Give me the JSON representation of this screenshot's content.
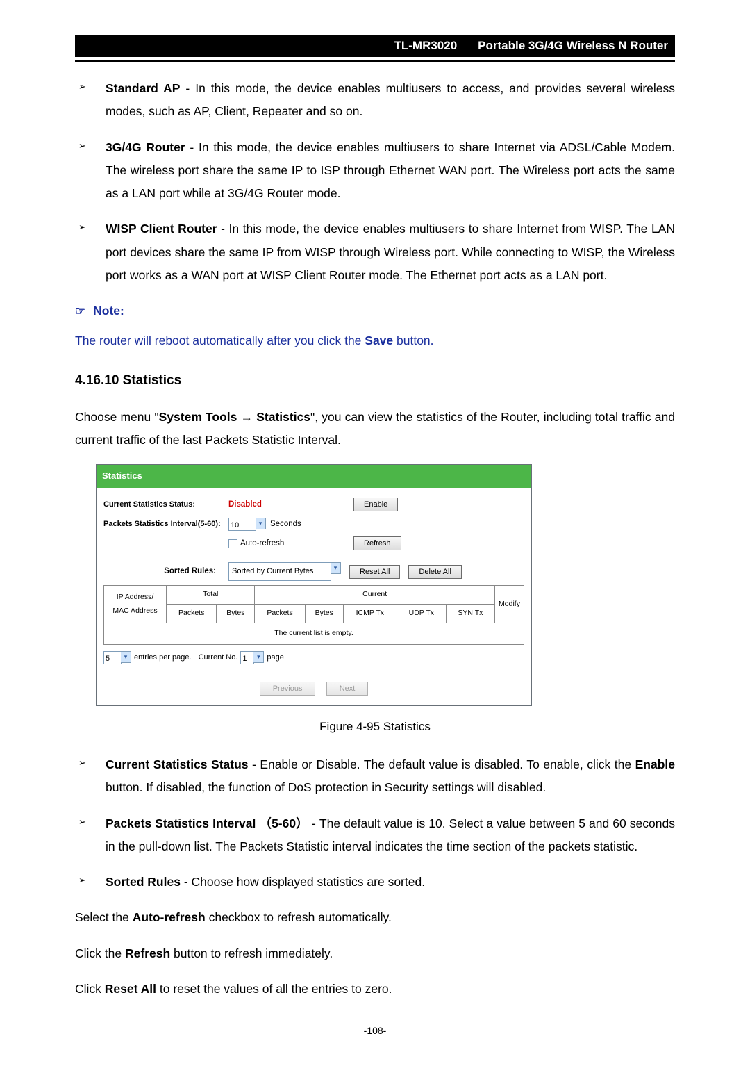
{
  "header": {
    "model": "TL-MR3020",
    "title": "Portable 3G/4G Wireless N Router"
  },
  "page_number": "-108-",
  "modes": {
    "standard_ap": {
      "name": "Standard AP",
      "sep": " - ",
      "desc": "In this mode, the device enables multiusers to access, and provides several wireless modes, such as AP, Client, Repeater and so on."
    },
    "g3g4": {
      "name": "3G/4G Router",
      "sep": " - ",
      "desc": "In this mode, the device enables multiusers to share Internet via ADSL/Cable Modem. The wireless port share the same IP to ISP through Ethernet WAN port. The Wireless port acts the same as a LAN port while at 3G/4G Router mode."
    },
    "wisp": {
      "name": "WISP Client Router",
      "sep": " - ",
      "desc": "In this mode, the device enables multiusers to share Internet from WISP. The LAN port devices share the same IP from WISP through Wireless port. While connecting to WISP, the Wireless port works as a WAN port at WISP Client Router mode. The Ethernet port acts as a LAN port."
    }
  },
  "note": {
    "icon": "☞",
    "label": "Note:",
    "text_pre": "The router will reboot automatically after you click the ",
    "text_bold": "Save",
    "text_post": " button."
  },
  "section": {
    "heading": "4.16.10 Statistics",
    "intro_pre": "Choose menu \"",
    "intro_b1": "System Tools",
    "intro_arrow": " → ",
    "intro_b2": "Statistics",
    "intro_post": "\", you can view the statistics of the Router, including total traffic and current traffic of the last Packets Statistic Interval."
  },
  "stats": {
    "panel_title": "Statistics",
    "row1_label": "Current Statistics Status:",
    "row1_value": "Disabled",
    "row1_btn": "Enable",
    "row2_label": "Packets Statistics Interval(5-60):",
    "row2_value": "10",
    "row2_unit": "Seconds",
    "auto_refresh": "Auto-refresh",
    "refresh_btn": "Refresh",
    "sorted_label": "Sorted Rules:",
    "sorted_value": "Sorted by Current Bytes",
    "reset_btn": "Reset All",
    "delete_btn": "Delete All",
    "th_total": "Total",
    "th_current": "Current",
    "th_ipmac": "IP Address/\nMAC Address",
    "th_packets": "Packets",
    "th_bytes": "Bytes",
    "th_icmp": "ICMP Tx",
    "th_udp": "UDP Tx",
    "th_syn": "SYN Tx",
    "th_modify": "Modify",
    "empty": "The current list is empty.",
    "entries_per": "5",
    "entries_txt": "entries per page.",
    "curno_label": "Current No.",
    "curno_val": "1",
    "page_txt": "page",
    "prev": "Previous",
    "next": "Next"
  },
  "caption": "Figure 4-95   Statistics",
  "defs": {
    "css": {
      "name": "Current Statistics Status",
      "sep": " - ",
      "desc_pre": "Enable or Disable. The default value is disabled. To enable, click the ",
      "desc_bold": "Enable",
      "desc_post": " button. If disabled, the function of DoS protection in Security settings will disabled."
    },
    "psi": {
      "name": "Packets Statistics Interval",
      "paren": "（5-60）",
      "sep": " - ",
      "desc": "The default value is 10. Select a value between 5 and 60 seconds in the pull-down list. The Packets Statistic interval indicates the time section of the packets statistic."
    },
    "sorted": {
      "name": "Sorted Rules",
      "sep": " - ",
      "desc": "Choose how displayed statistics are sorted."
    }
  },
  "tail": {
    "p1_pre": "Select the ",
    "p1_b": "Auto-refresh",
    "p1_post": " checkbox to refresh automatically.",
    "p2_pre": "Click the ",
    "p2_b": "Refresh",
    "p2_post": " button to refresh immediately.",
    "p3_pre": "Click ",
    "p3_b": "Reset All",
    "p3_post": " to reset the values of all the entries to zero."
  },
  "chart_data": {
    "type": "table",
    "title": "Statistics",
    "columns": [
      "IP Address/MAC Address",
      "Total Packets",
      "Total Bytes",
      "Current Packets",
      "Current Bytes",
      "ICMP Tx",
      "UDP Tx",
      "SYN Tx",
      "Modify"
    ],
    "rows": [],
    "note": "The current list is empty."
  }
}
